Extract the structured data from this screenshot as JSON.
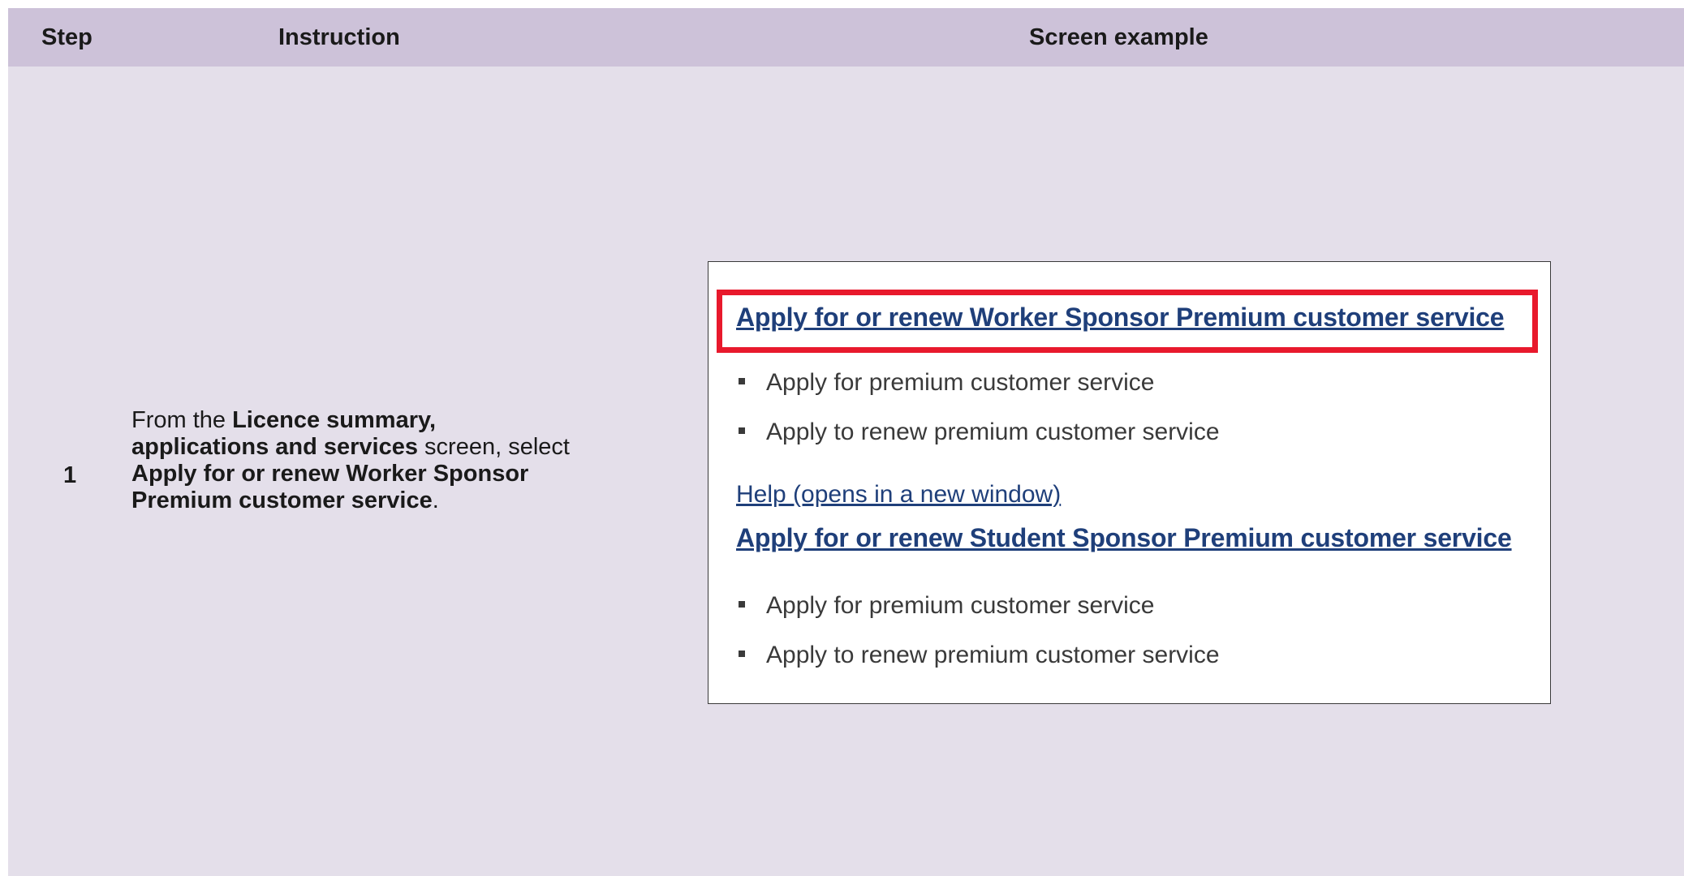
{
  "table": {
    "headers": {
      "step": "Step",
      "instruction": "Instruction",
      "screen_example": "Screen example"
    },
    "rows": [
      {
        "step": "1",
        "instruction": {
          "part1": "From the ",
          "bold1": "Licence summary, applications and services",
          "part2": " screen, select ",
          "bold2": "Apply for or renew Worker Sponsor Premium customer service",
          "part3": "."
        }
      }
    ]
  },
  "screen_example": {
    "worker_link": "Apply for or renew Worker Sponsor Premium customer service",
    "worker_items": [
      "Apply for premium customer service",
      "Apply to renew premium customer service"
    ],
    "help_link": "Help (opens in a new window)",
    "student_link": "Apply for or renew Student Sponsor Premium customer service",
    "student_items": [
      "Apply for premium customer service",
      "Apply to renew premium customer service"
    ],
    "highlight_color": "#e8192c"
  },
  "colors": {
    "header_bg": "#cdc2d9",
    "row_bg": "#e4dfea",
    "link": "#1f3f7a"
  }
}
